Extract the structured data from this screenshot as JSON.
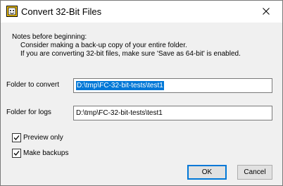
{
  "window": {
    "title": "Convert 32-Bit Files"
  },
  "notes": {
    "heading": "Notes before beginning:",
    "line1": "Consider making a back-up copy of your entire folder.",
    "line2": "If you are converting 32-bit files, make sure 'Save as 64-bit' is enabled."
  },
  "form": {
    "folder_to_convert_label": "Folder to convert",
    "folder_to_convert_value": "D:\\tmp\\FC-32-bit-tests\\test1",
    "folder_for_logs_label": "Folder for logs",
    "folder_for_logs_value": "D:\\tmp\\FC-32-bit-tests\\test1"
  },
  "options": {
    "preview_only_label": "Preview only",
    "preview_only_checked": true,
    "make_backups_label": "Make backups",
    "make_backups_checked": true
  },
  "buttons": {
    "ok_label": "OK",
    "cancel_label": "Cancel"
  },
  "icons": {
    "app": "app-icon",
    "close": "close-icon",
    "checkmark": "checkmark-icon"
  },
  "colors": {
    "accent": "#0078d7",
    "dialog_background": "#f0f0f0"
  }
}
